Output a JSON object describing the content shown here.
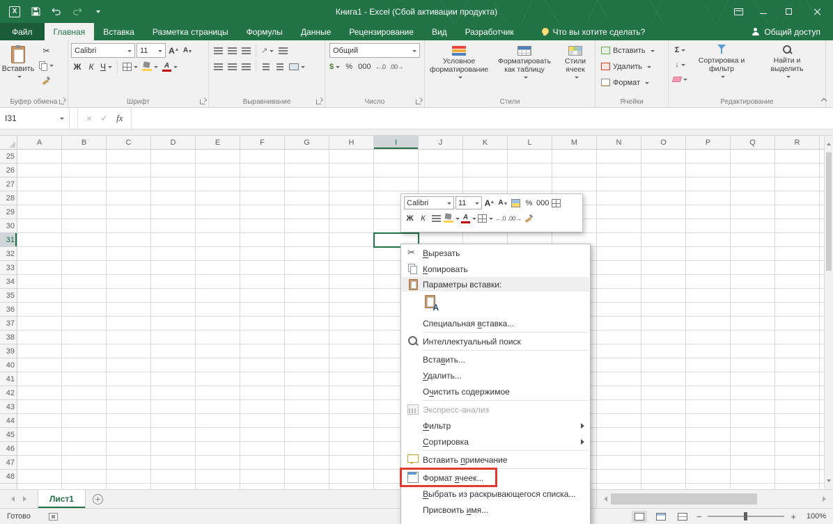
{
  "theme": {
    "accent": "#217346"
  },
  "title_bar": {
    "title": "Книга1 - Excel (Сбой активации продукта)"
  },
  "ribbon": {
    "tabs": [
      {
        "label": "Файл",
        "file": true
      },
      {
        "label": "Главная",
        "active": true
      },
      {
        "label": "Вставка"
      },
      {
        "label": "Разметка страницы"
      },
      {
        "label": "Формулы"
      },
      {
        "label": "Данные"
      },
      {
        "label": "Рецензирование"
      },
      {
        "label": "Вид"
      },
      {
        "label": "Разработчик"
      }
    ],
    "tell_me": "Что вы хотите сделать?",
    "share": "Общий доступ",
    "clipboard": {
      "group": "Буфер обмена",
      "paste": "Вставить"
    },
    "font": {
      "group": "Шрифт",
      "name": "Calibri",
      "size": "11",
      "bold": "Ж",
      "italic": "К",
      "underline": "Ч",
      "letter": "А"
    },
    "alignment": {
      "group": "Выравнивание"
    },
    "number": {
      "group": "Число",
      "format": "Общий",
      "percent": "%",
      "thousands": "000"
    },
    "styles": {
      "group": "Стили",
      "conditional": "Условное форматирование",
      "format_table": "Форматировать как таблицу",
      "cell_styles": "Стили ячеек"
    },
    "cells": {
      "group": "Ячейки",
      "insert": "Вставить",
      "delete": "Удалить",
      "format": "Формат"
    },
    "editing": {
      "group": "Редактирование",
      "autosum": "Σ",
      "sort_filter": "Сортировка и фильтр",
      "find_select": "Найти и выделить"
    }
  },
  "formula_bar": {
    "name_box": "I31",
    "fx": "fx"
  },
  "grid": {
    "columns": [
      "A",
      "B",
      "C",
      "D",
      "E",
      "F",
      "G",
      "H",
      "I",
      "J",
      "K",
      "L",
      "M",
      "N",
      "O",
      "P",
      "Q",
      "R"
    ],
    "rows": [
      25,
      26,
      27,
      28,
      29,
      30,
      31,
      32,
      33,
      34,
      35,
      36,
      37,
      38,
      39,
      40,
      41,
      42,
      43,
      44,
      45,
      46,
      47,
      48
    ],
    "selected_column": "I",
    "selected_row": 31,
    "selected_cell": "I31"
  },
  "mini_toolbar": {
    "font_name": "Calibri",
    "font_size": "11",
    "bold": "Ж",
    "italic": "К",
    "letter": "А",
    "percent": "%",
    "thousands": "000"
  },
  "context_menu": {
    "paste_glyph": "A",
    "items": [
      {
        "label": "Вырезать",
        "u": 0,
        "icon": "scissors-icon"
      },
      {
        "label": "Копировать",
        "u": 0,
        "icon": "copy-icon"
      },
      {
        "label": "Параметры вставки:",
        "type": "header",
        "icon": "clipboard-icon"
      },
      {
        "type": "paste-options"
      },
      {
        "label": "Специальная вставка...",
        "u": 12
      },
      {
        "type": "sep"
      },
      {
        "label": "Интеллектуальный поиск",
        "icon": "smart-lookup-icon"
      },
      {
        "type": "sep"
      },
      {
        "label": "Вставить...",
        "u": 4
      },
      {
        "label": "Удалить...",
        "u": 0
      },
      {
        "label": "Очистить содержимое",
        "u": 1
      },
      {
        "type": "sep"
      },
      {
        "label": "Экспресс-анализ",
        "disabled": true,
        "icon": "quick-analysis-icon"
      },
      {
        "label": "Фильтр",
        "u": 0,
        "submenu": true
      },
      {
        "label": "Сортировка",
        "u": 0,
        "submenu": true
      },
      {
        "type": "sep"
      },
      {
        "label": "Вставить примечание",
        "u": 9,
        "icon": "comment-icon"
      },
      {
        "type": "sep"
      },
      {
        "label": "Формат ячеек...",
        "u": 7,
        "icon": "format-cells-icon",
        "annotated": true
      },
      {
        "label": "Выбрать из раскрывающегося списка...",
        "u": 0
      },
      {
        "label": "Присвоить имя...",
        "u": 10
      }
    ]
  },
  "annotation": {
    "color": "#e23b2e",
    "target": "Формат ячеек..."
  },
  "sheet_bar": {
    "tabs": [
      {
        "label": "Лист1",
        "active": true
      }
    ]
  },
  "status_bar": {
    "status": "Готово",
    "zoom": "100%"
  }
}
